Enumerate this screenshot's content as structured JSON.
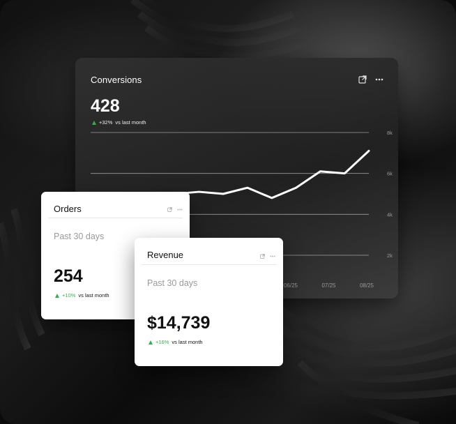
{
  "conversions": {
    "title": "Conversions",
    "value": "428",
    "change_pct": "+32%",
    "change_text": "vs last month",
    "trend": "up",
    "icons": [
      "external-link-icon",
      "more-icon"
    ]
  },
  "chart_data": {
    "type": "line",
    "x": [
      "",
      "",
      "",
      "",
      "",
      "",
      "06/25",
      "07/25",
      "08/25"
    ],
    "y_tick_labels": [
      "2k",
      "4k",
      "6k",
      "8k"
    ],
    "ylim": [
      2000,
      8000
    ],
    "grid": true,
    "series": [
      {
        "values": [
          4500,
          4800,
          5000,
          5100,
          5000,
          5300,
          4800,
          5300,
          6100,
          6000,
          7100
        ]
      }
    ]
  },
  "orders": {
    "title": "Orders",
    "period": "Past 30 days",
    "value": "254",
    "change_pct": "+10%",
    "change_text": "vs last month",
    "trend": "up"
  },
  "revenue": {
    "title": "Revenue",
    "period": "Past 30 days",
    "value": "$14,739",
    "change_pct": "+16%",
    "change_text": "vs last month",
    "trend": "up"
  },
  "colors": {
    "positive": "#2db34a",
    "card_bg": "#ffffff",
    "dark_card_bg": "#2a2a2a"
  }
}
